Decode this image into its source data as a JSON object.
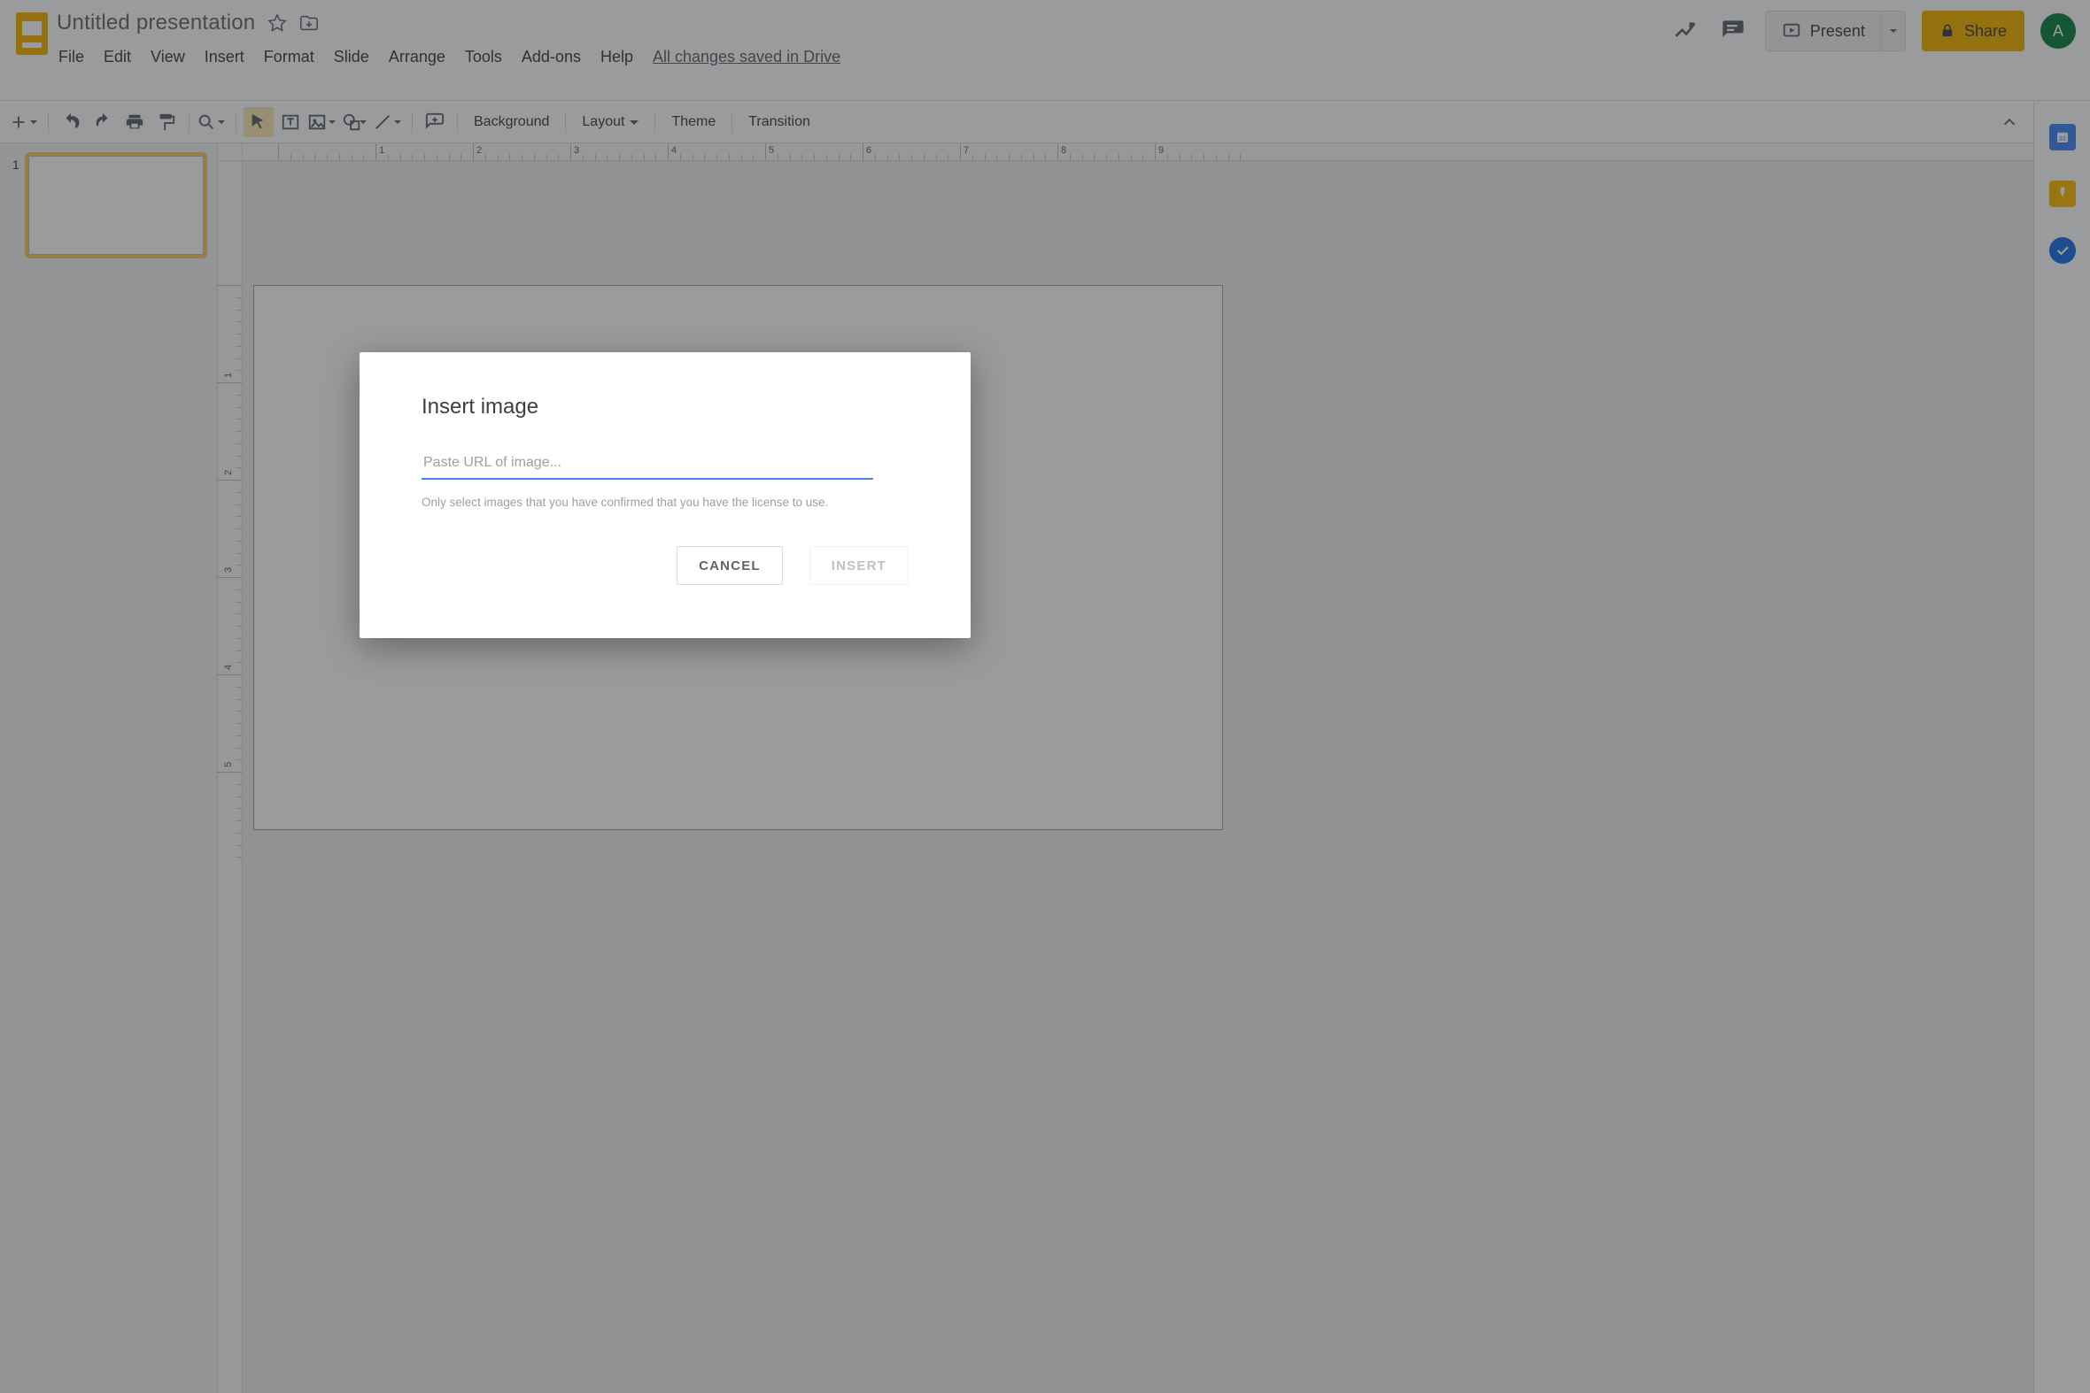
{
  "header": {
    "doc_title": "Untitled presentation",
    "menus": [
      "File",
      "Edit",
      "View",
      "Insert",
      "Format",
      "Slide",
      "Arrange",
      "Tools",
      "Add-ons",
      "Help"
    ],
    "drive_status": "All changes saved in Drive",
    "present_label": "Present",
    "share_label": "Share",
    "avatar_initial": "A"
  },
  "toolbar": {
    "background": "Background",
    "layout": "Layout",
    "theme": "Theme",
    "transition": "Transition"
  },
  "filmstrip": {
    "slides": [
      {
        "number": "1"
      }
    ]
  },
  "ruler": {
    "h_ticks": [
      "",
      "1",
      "2",
      "3",
      "4",
      "5",
      "6",
      "7",
      "8",
      "9"
    ],
    "v_ticks": [
      "",
      "1",
      "2",
      "3",
      "4",
      "5"
    ]
  },
  "dialog": {
    "title": "Insert image",
    "placeholder": "Paste URL of image...",
    "hint": "Only select images that you have confirmed that you have the license to use.",
    "cancel": "CANCEL",
    "insert": "INSERT"
  }
}
